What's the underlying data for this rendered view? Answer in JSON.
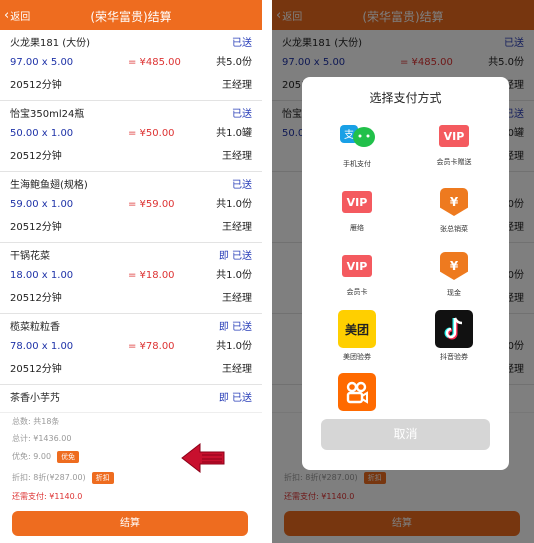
{
  "header": {
    "back_label": "返回",
    "title": "(荣华富贵)结算"
  },
  "items": [
    {
      "name": "火龙果181 (大份)",
      "status": "已送",
      "qty": "97.00 x 5.00",
      "price": "= ¥485.00",
      "total": "共5.0份",
      "duration": "20512分钟",
      "manager": "王经理"
    },
    {
      "name": "怡宝350ml24瓶",
      "status": "已送",
      "qty": "50.00 x 1.00",
      "price": "= ¥50.00",
      "total": "共1.0罐",
      "duration": "20512分钟",
      "manager": "王经理"
    },
    {
      "name": "生海鲍鱼翅(规格)",
      "status": "已送",
      "qty": "59.00 x 1.00",
      "price": "= ¥59.00",
      "total": "共1.0份",
      "duration": "20512分钟",
      "manager": "王经理"
    },
    {
      "name": "干锅花菜",
      "status": "即 已送",
      "qty": "18.00 x 1.00",
      "price": "= ¥18.00",
      "total": "共1.0份",
      "duration": "20512分钟",
      "manager": "王经理"
    },
    {
      "name": "榄菜粒粒香",
      "status": "即 已送",
      "qty": "78.00 x 1.00",
      "price": "= ¥78.00",
      "total": "共1.0份",
      "duration": "20512分钟",
      "manager": "王经理"
    },
    {
      "name": "茶香小芋艿",
      "status": "即 已送",
      "qty": "",
      "price": "",
      "total": "",
      "duration": "",
      "manager": ""
    }
  ],
  "summary": {
    "count": "总数: 共18条",
    "total": "总计: ¥1436.00",
    "discount": "优免: 9.00",
    "discount_tag": "优免",
    "fold": "折扣: 8折(¥287.00)",
    "fold_tag": "折扣",
    "due": "还需支付: ¥1140.0",
    "pay_button": "结算"
  },
  "modal": {
    "title": "选择支付方式",
    "options": [
      {
        "label": "手机支付",
        "icon": "mobile-pay-icon"
      },
      {
        "label": "会员卡赠送",
        "icon": "vip-gift-icon",
        "text": "VIP"
      },
      {
        "label": "雁络",
        "icon": "vip-icon",
        "text": "VIP"
      },
      {
        "label": "张总销菜",
        "icon": "yen-tag-icon",
        "text": "¥"
      },
      {
        "label": "会员卡",
        "icon": "vip-card-icon",
        "text": "VIP"
      },
      {
        "label": "现金",
        "icon": "cash-icon",
        "text": "¥"
      },
      {
        "label": "美团验券",
        "icon": "meituan-icon",
        "text": "美团"
      },
      {
        "label": "抖音验券",
        "icon": "douyin-icon"
      },
      {
        "label": "",
        "icon": "kuaishou-icon"
      }
    ],
    "cancel": "取消"
  },
  "colors": {
    "brand": "#ee6c1f",
    "price": "#dd3333",
    "link": "#2a3fb8"
  }
}
